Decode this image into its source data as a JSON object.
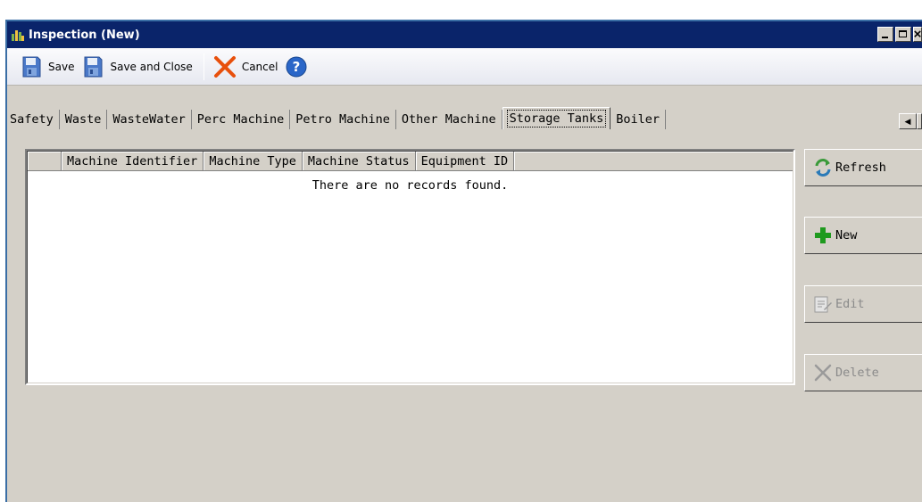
{
  "window": {
    "title": "Inspection (New)",
    "caption_buttons": [
      "minimize",
      "maximize",
      "close"
    ]
  },
  "toolbar": {
    "save_label": "Save",
    "save_close_label": "Save and Close",
    "cancel_label": "Cancel"
  },
  "tabs": [
    {
      "label": "Safety"
    },
    {
      "label": "Waste"
    },
    {
      "label": "WasteWater"
    },
    {
      "label": "Perc Machine"
    },
    {
      "label": "Petro Machine"
    },
    {
      "label": "Other Machine"
    },
    {
      "label": "Storage Tanks",
      "active": true
    },
    {
      "label": "Boiler"
    }
  ],
  "grid": {
    "columns": [
      "Machine Identifier",
      "Machine Type",
      "Machine Status",
      "Equipment ID"
    ],
    "empty_message": "There are no records found."
  },
  "actions": {
    "refresh_label": "Refresh",
    "new_label": "New",
    "edit_label": "Edit",
    "delete_label": "Delete"
  },
  "colors": {
    "titlebar": "#0a246a",
    "face": "#d4d0c8",
    "accent_add": "#1e9a1e",
    "accent_cancel": "#e8500c",
    "help": "#2a66c8"
  }
}
